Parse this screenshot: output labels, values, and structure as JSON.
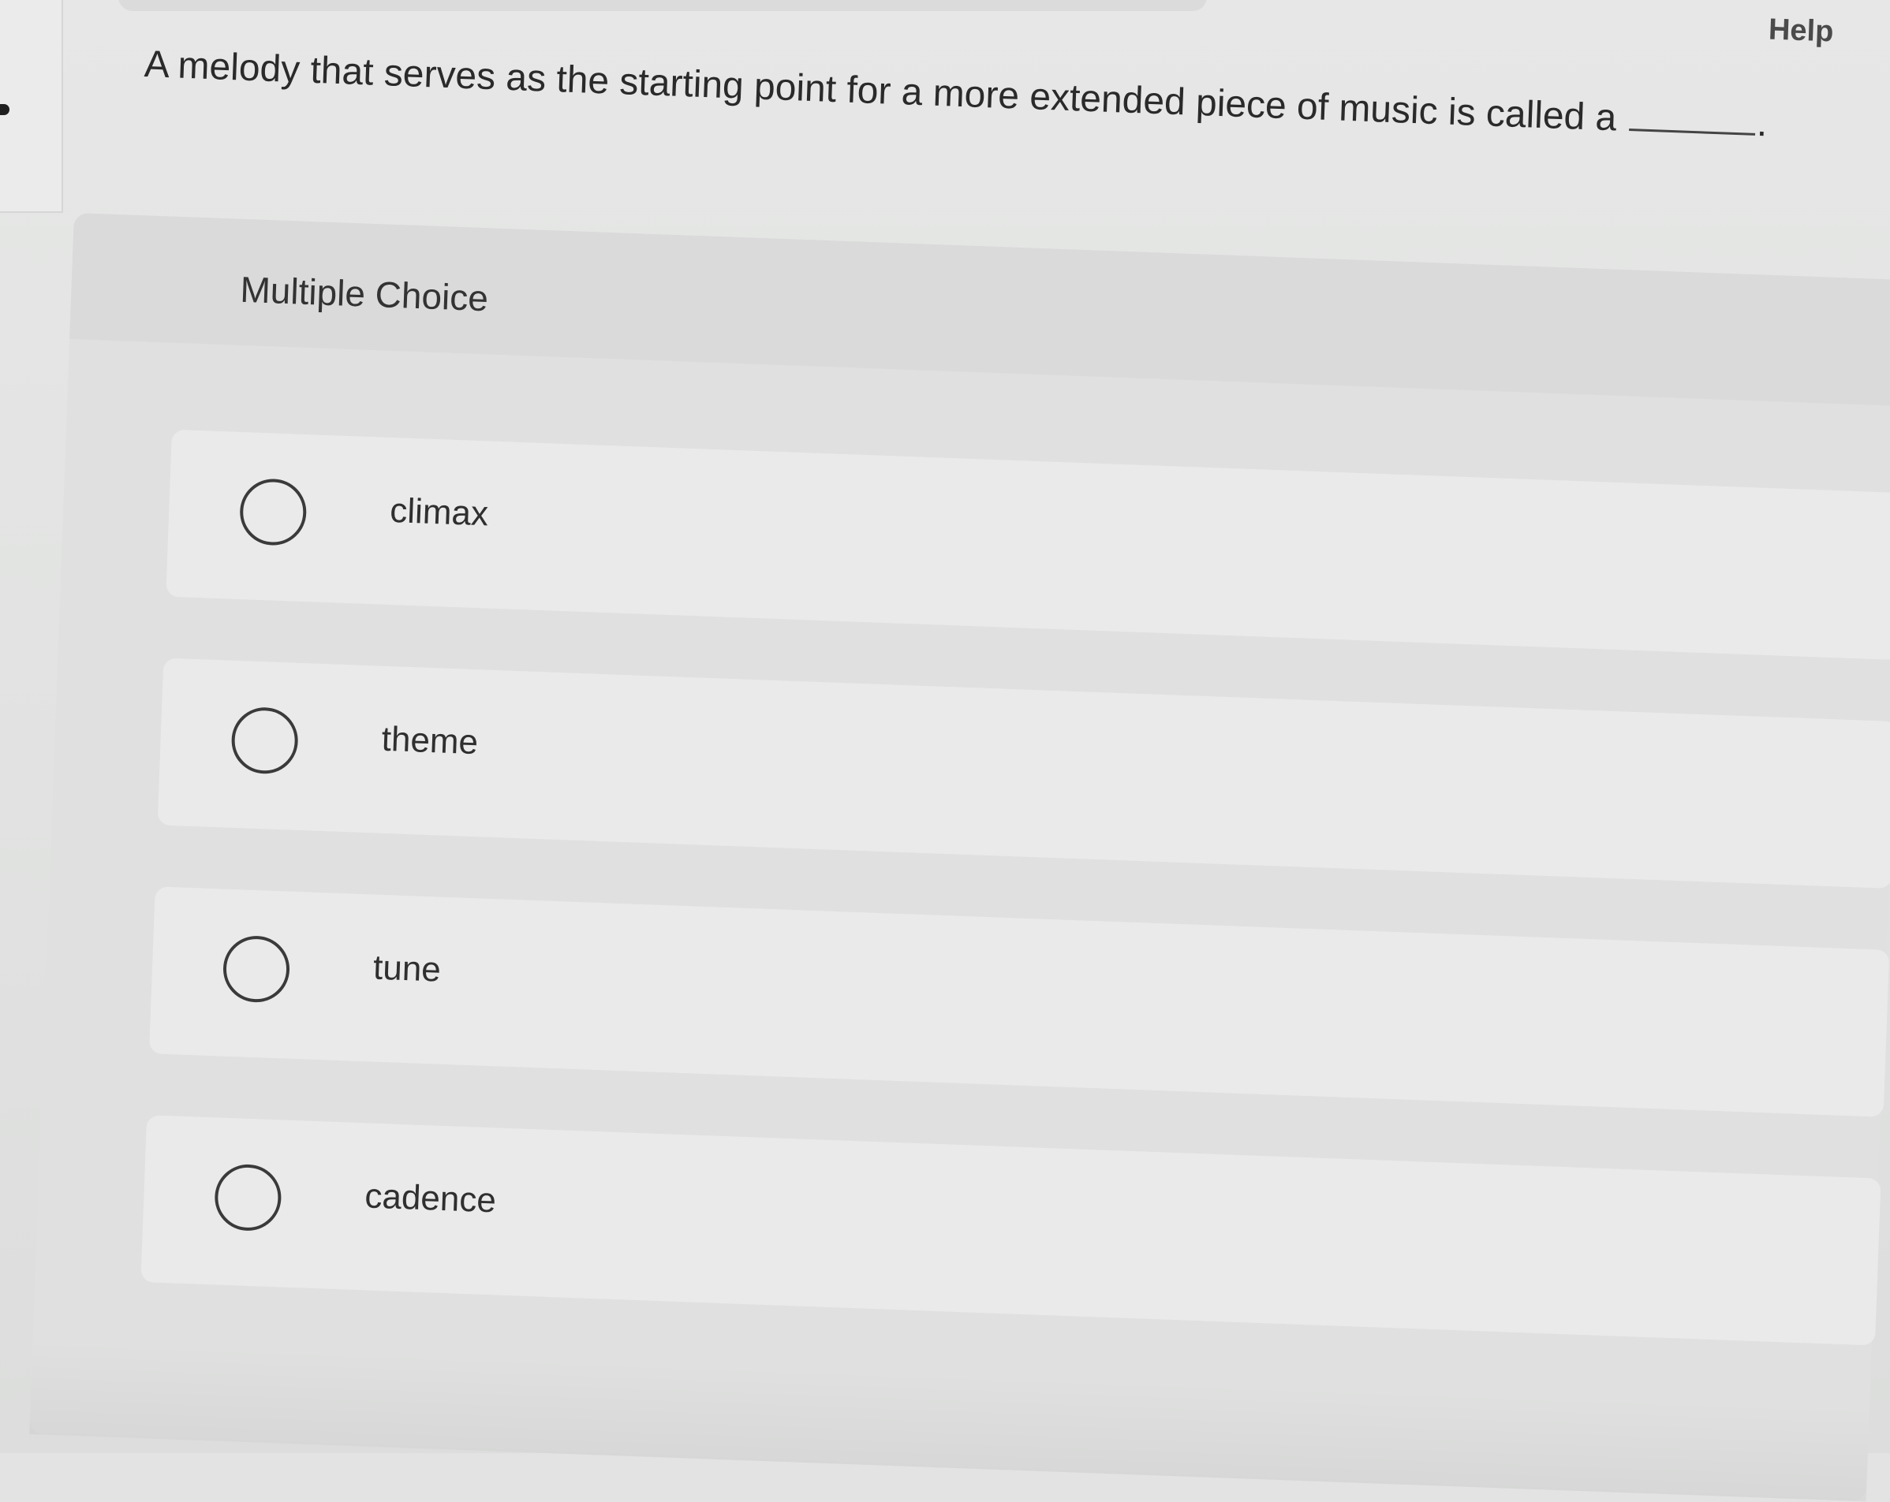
{
  "header": {
    "help_label": "Help"
  },
  "question": {
    "text": "A melody that serves as the starting point for a more extended piece of music is called a",
    "end_punctuation": "."
  },
  "multiple_choice": {
    "title": "Multiple Choice",
    "options": [
      {
        "label": "climax"
      },
      {
        "label": "theme"
      },
      {
        "label": "tune"
      },
      {
        "label": "cadence"
      }
    ]
  }
}
